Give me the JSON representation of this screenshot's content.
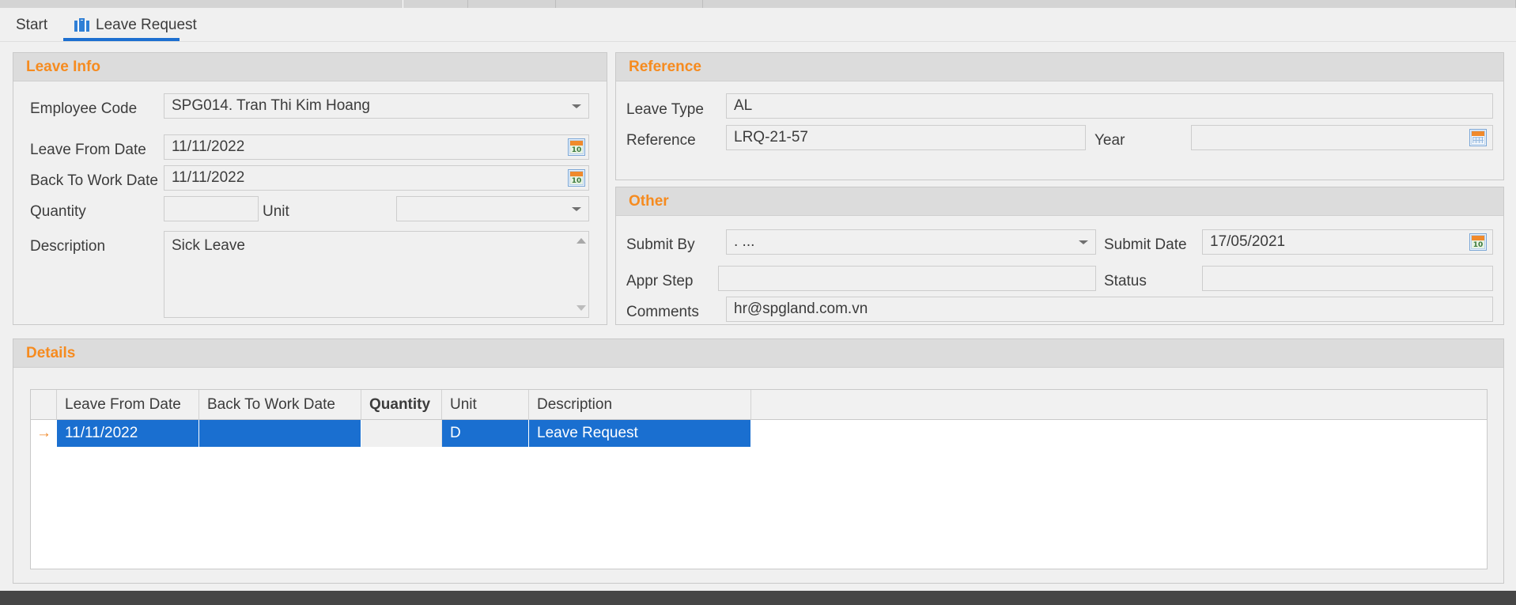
{
  "tabs": [
    {
      "label": "Start",
      "icon": null,
      "active": false
    },
    {
      "label": "Leave Request",
      "icon": "briefcase-icon",
      "active": true
    }
  ],
  "leave_info": {
    "title": "Leave Info",
    "employee_code": {
      "label": "Employee Code",
      "value": "SPG014. Tran Thi Kim Hoang",
      "icon": "chevron-down-icon"
    },
    "leave_from_date": {
      "label": "Leave From Date",
      "value": "11/11/2022",
      "icon": "calendar-icon"
    },
    "back_to_work_date": {
      "label": "Back To Work Date",
      "value": "11/11/2022",
      "icon": "calendar-icon"
    },
    "quantity": {
      "label": "Quantity",
      "value": ""
    },
    "unit": {
      "label": "Unit",
      "value": "",
      "icon": "chevron-down-icon"
    },
    "description": {
      "label": "Description",
      "value": "Sick Leave",
      "scroll_up_icon": "scroll-up-icon",
      "scroll_down_icon": "scroll-down-icon"
    }
  },
  "reference": {
    "title": "Reference",
    "leave_type": {
      "label": "Leave Type",
      "value": "AL"
    },
    "reference_no": {
      "label": "Reference",
      "value": "LRQ-21-57"
    },
    "year": {
      "label": "Year",
      "value": "",
      "icon": "calendar-grid-icon"
    }
  },
  "other": {
    "title": "Other",
    "submit_by": {
      "label": "Submit By",
      "value": ". ...",
      "icon": "chevron-down-icon"
    },
    "submit_date": {
      "label": "Submit Date",
      "value": "17/05/2021",
      "icon": "calendar-icon"
    },
    "appr_step": {
      "label": "Appr Step",
      "value": ""
    },
    "status": {
      "label": "Status",
      "value": ""
    },
    "comments": {
      "label": "Comments",
      "value": "hr@spgland.com.vn"
    }
  },
  "details": {
    "title": "Details",
    "columns": [
      "Leave From Date",
      "Back To Work Date",
      "Quantity",
      "Unit",
      "Description"
    ],
    "rows": [
      {
        "indicator": "→",
        "leave_from_date": "11/11/2022",
        "back_to_work_date": "",
        "quantity": "",
        "unit": "D",
        "description": "Leave Request"
      }
    ]
  },
  "icons": {
    "calendar_day_number": "10",
    "row_indicator": "→"
  },
  "colors": {
    "group_title": "#f68b1f",
    "selection_blue": "#1a6fd0",
    "tab_underline": "#1d6fd0",
    "panel_header_bg": "#dcdcdc",
    "footer_bg": "#464646"
  }
}
